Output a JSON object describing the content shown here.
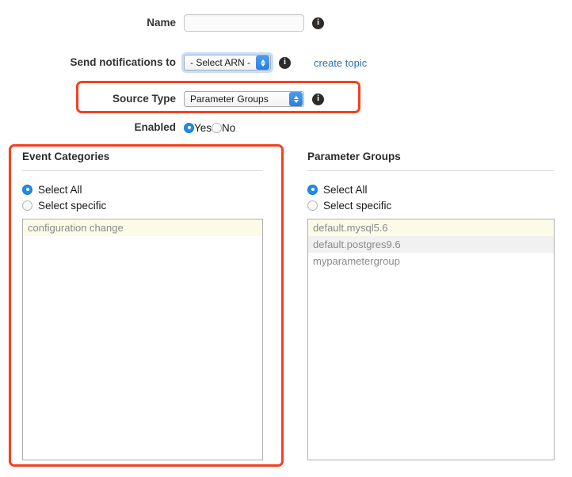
{
  "form": {
    "rows": [
      {
        "label": "Name",
        "type": "text",
        "value": "",
        "placeholder": ""
      },
      {
        "label": "Send notifications to",
        "type": "select",
        "value": "- Select ARN -"
      },
      {
        "label": "Source Type",
        "type": "select",
        "value": "Parameter Groups"
      },
      {
        "label": "Enabled",
        "type": "radio"
      }
    ],
    "name_label": "Name",
    "name_value": "",
    "name_placeholder": "",
    "send_notifications_label": "Send notifications to",
    "send_notifications_value": "- Select ARN -",
    "source_type_label": "Source Type",
    "source_type_value": "Parameter Groups",
    "enabled_label": "Enabled",
    "enabled_yes": "Yes",
    "enabled_no": "No",
    "create_topic_link": "create topic",
    "info_glyph": "i"
  },
  "event_categories": {
    "title": "Event Categories",
    "select_all_label": "Select All",
    "select_specific_label": "Select specific",
    "selected_mode": "Select All",
    "items": [
      "configuration change"
    ]
  },
  "parameter_groups": {
    "title": "Parameter Groups",
    "select_all_label": "Select All",
    "select_specific_label": "Select specific",
    "selected_mode": "Select All",
    "items": [
      "default.mysql5.6",
      "default.postgres9.6",
      "myparametergroup"
    ]
  },
  "annotations": {
    "highlight_color": "#f5401f",
    "boxes": [
      {
        "name": "source-type-highlight"
      },
      {
        "name": "event-categories-highlight"
      }
    ]
  }
}
